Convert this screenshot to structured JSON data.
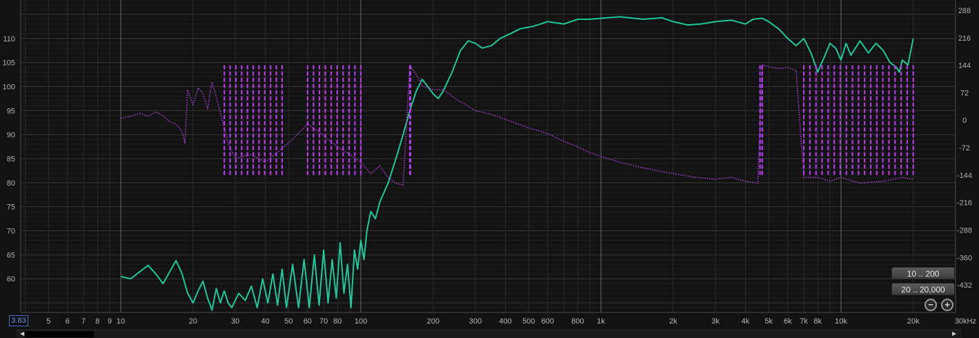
{
  "chart_data": {
    "type": "line",
    "title": "",
    "x_scale": "log",
    "x_unit_label": "kHz",
    "x_tick_labels": [
      {
        "v": 5,
        "t": "5"
      },
      {
        "v": 6,
        "t": "6"
      },
      {
        "v": 7,
        "t": "7"
      },
      {
        "v": 8,
        "t": "8"
      },
      {
        "v": 9,
        "t": "9"
      },
      {
        "v": 10,
        "t": "10"
      },
      {
        "v": 20,
        "t": "20"
      },
      {
        "v": 30,
        "t": "30"
      },
      {
        "v": 40,
        "t": "40"
      },
      {
        "v": 50,
        "t": "50"
      },
      {
        "v": 60,
        "t": "60"
      },
      {
        "v": 70,
        "t": "70"
      },
      {
        "v": 80,
        "t": "80"
      },
      {
        "v": 100,
        "t": "100"
      },
      {
        "v": 200,
        "t": "200"
      },
      {
        "v": 300,
        "t": "300"
      },
      {
        "v": 400,
        "t": "400"
      },
      {
        "v": 500,
        "t": "500"
      },
      {
        "v": 600,
        "t": "600"
      },
      {
        "v": 800,
        "t": "800"
      },
      {
        "v": 1000,
        "t": "1k"
      },
      {
        "v": 2000,
        "t": "2k"
      },
      {
        "v": 3000,
        "t": "3k"
      },
      {
        "v": 4000,
        "t": "4k"
      },
      {
        "v": 5000,
        "t": "5k"
      },
      {
        "v": 6000,
        "t": "6k"
      },
      {
        "v": 7000,
        "t": "7k"
      },
      {
        "v": 8000,
        "t": "8k"
      },
      {
        "v": 10000,
        "t": "10k"
      },
      {
        "v": 20000,
        "t": "20k"
      },
      {
        "v": 30000,
        "t": "30kHz"
      }
    ],
    "x_range": [
      3.83,
      30000
    ],
    "y_left_range": [
      53,
      118
    ],
    "y_left_ticks": [
      60,
      65,
      70,
      75,
      80,
      85,
      90,
      95,
      100,
      105,
      110
    ],
    "y_right_range": [
      -504,
      315
    ],
    "y_right_ticks": [
      288,
      216,
      144,
      72,
      0,
      -72,
      -144,
      -216,
      -288,
      -360,
      -432
    ],
    "grid": true,
    "series": [
      {
        "color": "#1ec99a",
        "axis": "left",
        "style": "solid",
        "points": [
          [
            10,
            60.5
          ],
          [
            11,
            60
          ],
          [
            12,
            61.5
          ],
          [
            13,
            62.8
          ],
          [
            14,
            61
          ],
          [
            15,
            59
          ],
          [
            16,
            61.5
          ],
          [
            17,
            63.8
          ],
          [
            18,
            61
          ],
          [
            19,
            57
          ],
          [
            20,
            55
          ],
          [
            21,
            57.5
          ],
          [
            22,
            59.5
          ],
          [
            23,
            56
          ],
          [
            24,
            53.5
          ],
          [
            25,
            58
          ],
          [
            26,
            55
          ],
          [
            27,
            57.5
          ],
          [
            28,
            55
          ],
          [
            29,
            54
          ],
          [
            31,
            57
          ],
          [
            33,
            55.5
          ],
          [
            35,
            58.5
          ],
          [
            37,
            54
          ],
          [
            39,
            60
          ],
          [
            41,
            55
          ],
          [
            43,
            61
          ],
          [
            45,
            54.5
          ],
          [
            47,
            62
          ],
          [
            49,
            54
          ],
          [
            52,
            63
          ],
          [
            55,
            54
          ],
          [
            58,
            64
          ],
          [
            61,
            54
          ],
          [
            64,
            65
          ],
          [
            67,
            54.5
          ],
          [
            70,
            66
          ],
          [
            73,
            55
          ],
          [
            76,
            64
          ],
          [
            79,
            56
          ],
          [
            82,
            67.5
          ],
          [
            85,
            57
          ],
          [
            88,
            63
          ],
          [
            91,
            54
          ],
          [
            94,
            66
          ],
          [
            97,
            62
          ],
          [
            100,
            68
          ],
          [
            103,
            64
          ],
          [
            106,
            70
          ],
          [
            110,
            74
          ],
          [
            115,
            72.5
          ],
          [
            120,
            76
          ],
          [
            130,
            80
          ],
          [
            140,
            85
          ],
          [
            150,
            90
          ],
          [
            160,
            95
          ],
          [
            170,
            99
          ],
          [
            180,
            101.5
          ],
          [
            190,
            100
          ],
          [
            200,
            98.5
          ],
          [
            210,
            97.5
          ],
          [
            220,
            99
          ],
          [
            240,
            103
          ],
          [
            260,
            107.5
          ],
          [
            280,
            109.5
          ],
          [
            300,
            109
          ],
          [
            320,
            108
          ],
          [
            350,
            108.5
          ],
          [
            380,
            110
          ],
          [
            420,
            111
          ],
          [
            460,
            112
          ],
          [
            520,
            112.5
          ],
          [
            600,
            113.5
          ],
          [
            700,
            113
          ],
          [
            800,
            114
          ],
          [
            900,
            114
          ],
          [
            1000,
            114.2
          ],
          [
            1200,
            114.5
          ],
          [
            1500,
            114
          ],
          [
            1800,
            114.3
          ],
          [
            2000,
            113.5
          ],
          [
            2300,
            112.8
          ],
          [
            2600,
            113
          ],
          [
            3000,
            113.5
          ],
          [
            3500,
            113.8
          ],
          [
            4000,
            113
          ],
          [
            4300,
            114
          ],
          [
            4700,
            114.2
          ],
          [
            5000,
            113.5
          ],
          [
            5500,
            112
          ],
          [
            6000,
            110
          ],
          [
            6500,
            108.5
          ],
          [
            7000,
            110
          ],
          [
            7500,
            107
          ],
          [
            8000,
            103
          ],
          [
            8500,
            106
          ],
          [
            9000,
            109
          ],
          [
            9500,
            108
          ],
          [
            10000,
            105.5
          ],
          [
            10500,
            109
          ],
          [
            11000,
            106.5
          ],
          [
            12000,
            109.5
          ],
          [
            13000,
            107
          ],
          [
            14000,
            109
          ],
          [
            15000,
            107.5
          ],
          [
            16000,
            105
          ],
          [
            17000,
            104
          ],
          [
            17500,
            103
          ],
          [
            18000,
            105.5
          ],
          [
            19000,
            104.5
          ],
          [
            20000,
            110
          ]
        ]
      },
      {
        "color": "#b43de6",
        "axis": "right",
        "style": "dotted",
        "points": [
          [
            10,
            5
          ],
          [
            11,
            10
          ],
          [
            12,
            18
          ],
          [
            13,
            10
          ],
          [
            14,
            22
          ],
          [
            15,
            12
          ],
          [
            16,
            -5
          ],
          [
            17,
            -10
          ],
          [
            18,
            -30
          ],
          [
            18.5,
            -60
          ],
          [
            19,
            80
          ],
          [
            20,
            40
          ],
          [
            21,
            85
          ],
          [
            22,
            70
          ],
          [
            23,
            30
          ],
          [
            24,
            100
          ],
          [
            25,
            60
          ],
          [
            26,
            20
          ],
          [
            28,
            -60
          ],
          [
            30,
            -100
          ],
          [
            35,
            -90
          ],
          [
            40,
            -110
          ],
          [
            50,
            -60
          ],
          [
            60,
            -10
          ],
          [
            70,
            -40
          ],
          [
            80,
            -70
          ],
          [
            90,
            -90
          ],
          [
            100,
            -110
          ],
          [
            110,
            -140
          ],
          [
            120,
            -120
          ],
          [
            130,
            -150
          ],
          [
            140,
            -165
          ],
          [
            150,
            -170
          ],
          [
            160,
            144
          ],
          [
            170,
            120
          ],
          [
            180,
            90
          ],
          [
            200,
            80
          ],
          [
            220,
            80
          ],
          [
            250,
            55
          ],
          [
            300,
            25
          ],
          [
            350,
            15
          ],
          [
            400,
            2
          ],
          [
            500,
            -20
          ],
          [
            600,
            -35
          ],
          [
            700,
            -55
          ],
          [
            800,
            -70
          ],
          [
            900,
            -85
          ],
          [
            1000,
            -95
          ],
          [
            1200,
            -110
          ],
          [
            1500,
            -125
          ],
          [
            2000,
            -140
          ],
          [
            2500,
            -150
          ],
          [
            3000,
            -155
          ],
          [
            3500,
            -150
          ],
          [
            4000,
            -160
          ],
          [
            4500,
            -165
          ],
          [
            4700,
            145
          ],
          [
            5000,
            140
          ],
          [
            5500,
            135
          ],
          [
            6000,
            138
          ],
          [
            6500,
            130
          ],
          [
            7000,
            -150
          ],
          [
            8000,
            -150
          ],
          [
            9000,
            -160
          ],
          [
            10000,
            -150
          ],
          [
            12000,
            -165
          ],
          [
            15000,
            -160
          ],
          [
            18000,
            -150
          ],
          [
            20000,
            -155
          ]
        ]
      }
    ]
  },
  "ui": {
    "x_left_readout": "3.83",
    "zoom_buttons": {
      "range_a": "10 .. 200",
      "range_b": "20 .. 20,000"
    },
    "zoom_out_symbol": "−",
    "zoom_in_symbol": "+"
  },
  "colors": {
    "background": "#121212",
    "grid_major": "#3c3c3c",
    "grid_minor": "#232323",
    "green": "#1ec99a",
    "purple": "#b43de6"
  }
}
